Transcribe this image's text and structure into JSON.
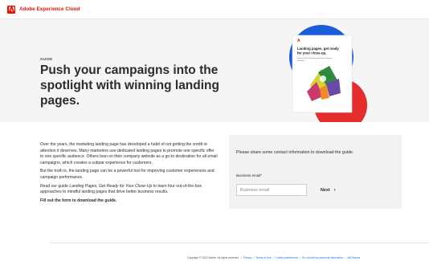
{
  "header": {
    "brand": "Adobe Experience Cloud",
    "logo_icon": "adobe-logo-icon",
    "brand_color": "#eb1000"
  },
  "hero": {
    "eyebrow": "GUIDE",
    "title": "Push your campaigns into the spotlight with winning landing pages.",
    "background": "#f5f5f5",
    "book": {
      "logo": "A",
      "title": "Landing pages, get ready for your close-up.",
      "subtitle": "Find your secret to landing pages that turn browsers into buyers."
    }
  },
  "body": {
    "p1": "Over the years, the marketing landing page has developed a habit of not getting the credit or attention it deserves. Many marketers use dedicated landing pages to promote one specific offer to one specific audience. Others lean on their company website as a go-to destination for all email campaigns, which creates a subpar experience for customers.",
    "p2": "But the truth is, the landing page can be a powerful tool for improving customer experiences and campaign performance.",
    "p3_before": "Read our guide ",
    "p3_italic": "Landing Pages, Get Ready for Your Close-Up",
    "p3_after": " to learn four out-of-the-box approaches to mindful landing pages that drive better business results.",
    "cta": "Fill out the form to download the guide."
  },
  "form": {
    "intro": "Please share some contact information to download the guide.",
    "email_label": "Business email*",
    "email_placeholder": "Business email",
    "email_value": "",
    "next_label": "Next",
    "next_icon": "chevron-right-icon"
  },
  "footer": {
    "copyright": "Copyright © 2022 Adobe. All rights reserved.",
    "links": [
      "Privacy",
      "Terms of Use",
      "Cookie preferences",
      "Do not sell my personal information",
      "AdChoices"
    ],
    "link_color": "#1473e6"
  }
}
